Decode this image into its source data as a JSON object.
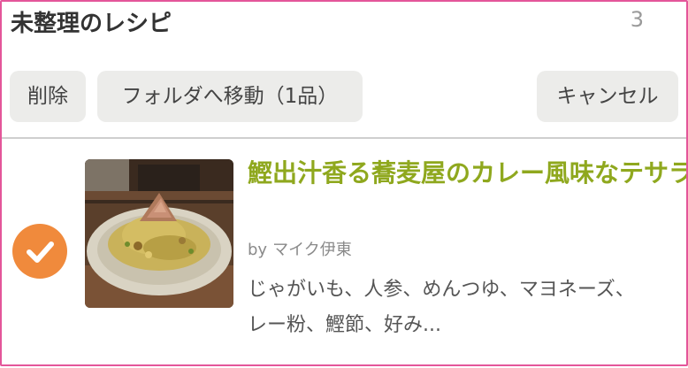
{
  "header": {
    "title": "未整理のレシピ",
    "count": "3"
  },
  "toolbar": {
    "delete_label": "削除",
    "move_label": "フォルダへ移動（1品）",
    "cancel_label": "キャンセル"
  },
  "recipe": {
    "title": "鰹出汁香る蕎麦屋のカレー風味なテサラ",
    "author_prefix": "by",
    "author_name": "マイク伊東",
    "description_line1": "じゃがいも、人参、めんつゆ、マヨネーズ、",
    "description_line2": "レー粉、鰹節、好み...",
    "selected": true
  },
  "colors": {
    "frame_border": "#e4569a",
    "title_green": "#8fa81e",
    "check_orange": "#f08a3c",
    "button_bg": "#ececea"
  },
  "icons": {
    "check": "check-icon"
  }
}
